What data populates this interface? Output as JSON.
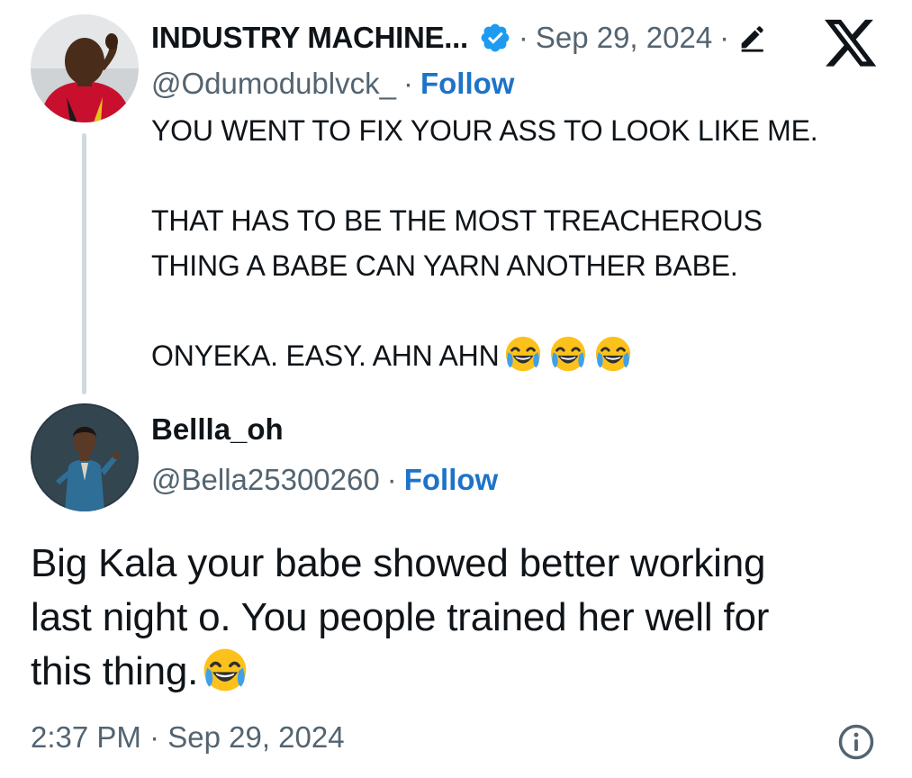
{
  "parent_tweet": {
    "display_name": "INDUSTRY MACHINE...",
    "verified": true,
    "separator": "·",
    "date": "Sep 29, 2024",
    "handle": "@Odumodublvck_",
    "follow_label": "Follow",
    "body_lines": [
      "YOU WENT TO FIX YOUR ASS TO LOOK LIKE ME.",
      "THAT HAS TO BE THE MOST TREACHEROUS",
      "THING A BABE CAN YARN ANOTHER BABE.",
      "ONYEKA. EASY. AHN AHN"
    ],
    "emoji_name": "face-with-tears-of-joy",
    "emoji_count": 3
  },
  "reply_tweet": {
    "display_name": "Bellla_oh",
    "handle": "@Bella25300260",
    "follow_label": "Follow",
    "body_lines": [
      "Big Kala your babe showed better working",
      "last night o. You people trained her well for",
      "this thing."
    ],
    "emoji_name": "face-with-tears-of-joy",
    "time": "2:37 PM",
    "date": "Sep 29, 2024"
  },
  "icons": {
    "logo": "x-logo-icon",
    "verified": "verified-badge-icon",
    "edit": "edit-pencil-icon",
    "info": "info-icon"
  },
  "colors": {
    "text": "#0f1419",
    "muted": "#536471",
    "link": "#1d73c8",
    "verified_blue": "#1d9bf0",
    "thread_line": "#cfd9de"
  }
}
